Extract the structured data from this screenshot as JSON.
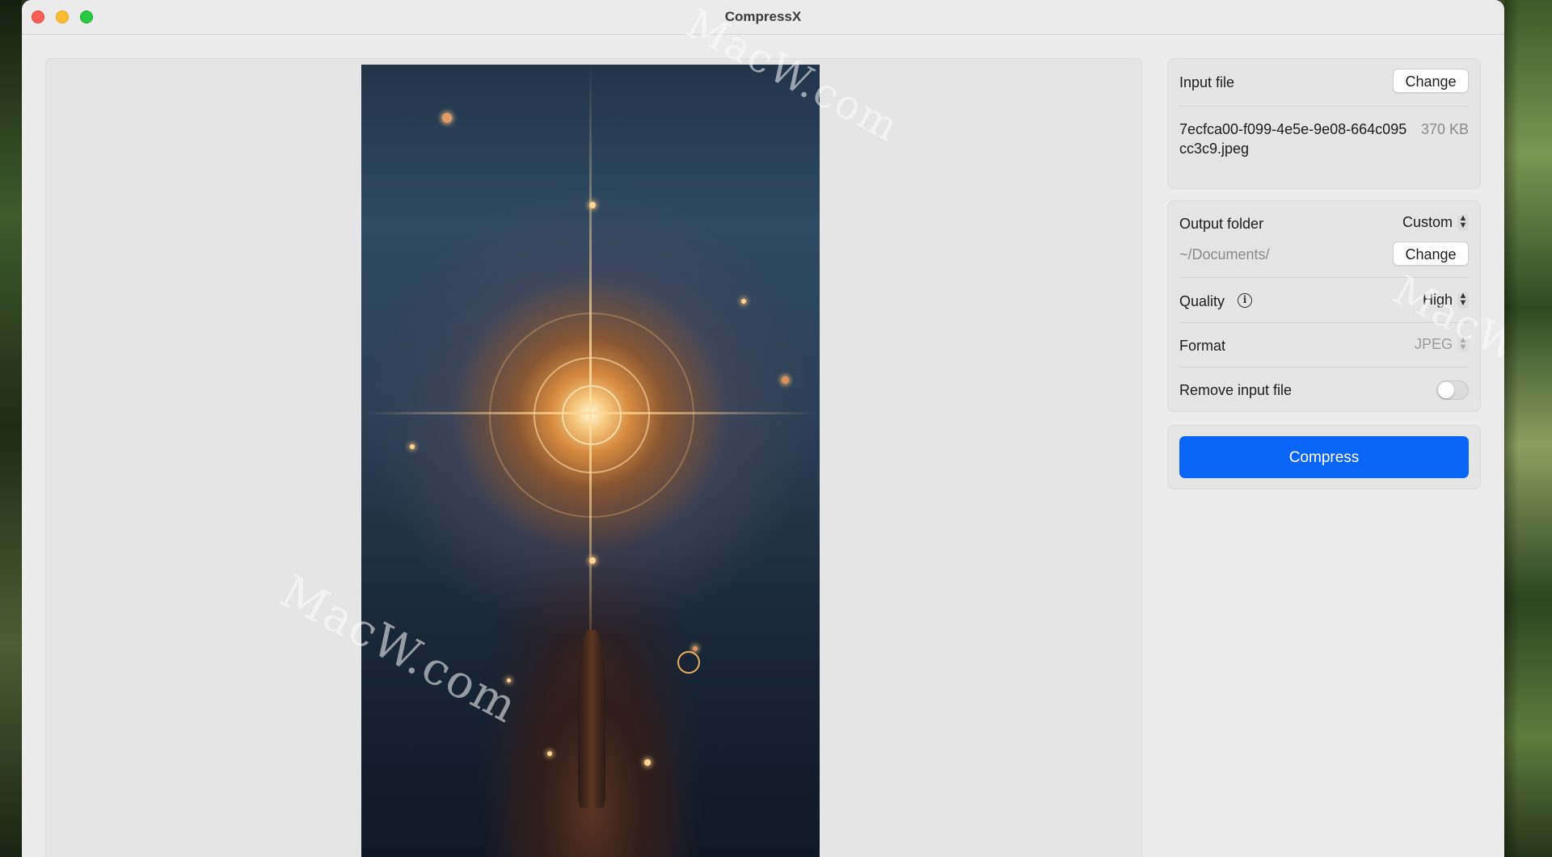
{
  "window": {
    "title": "CompressX"
  },
  "input_file": {
    "label": "Input file",
    "change_label": "Change",
    "file_name": "7ecfca00-f099-4e5e-9e08-664c095cc3c9.jpeg",
    "file_size": "370 KB"
  },
  "output": {
    "folder_label": "Output folder",
    "folder_mode": "Custom",
    "folder_path": "~/Documents/",
    "change_label": "Change",
    "quality_label": "Quality",
    "quality_value": "High",
    "format_label": "Format",
    "format_value": "JPEG",
    "remove_input_label": "Remove input file",
    "remove_input_enabled": false
  },
  "actions": {
    "compress_label": "Compress"
  },
  "watermark": {
    "text": "MacW.com"
  },
  "colors": {
    "accent": "#0a64f5",
    "close": "#fe5f57",
    "minimize": "#febc2e",
    "maximize": "#28c840"
  },
  "icons": {
    "info": "info-icon",
    "chevron": "chevron-updown-icon"
  }
}
